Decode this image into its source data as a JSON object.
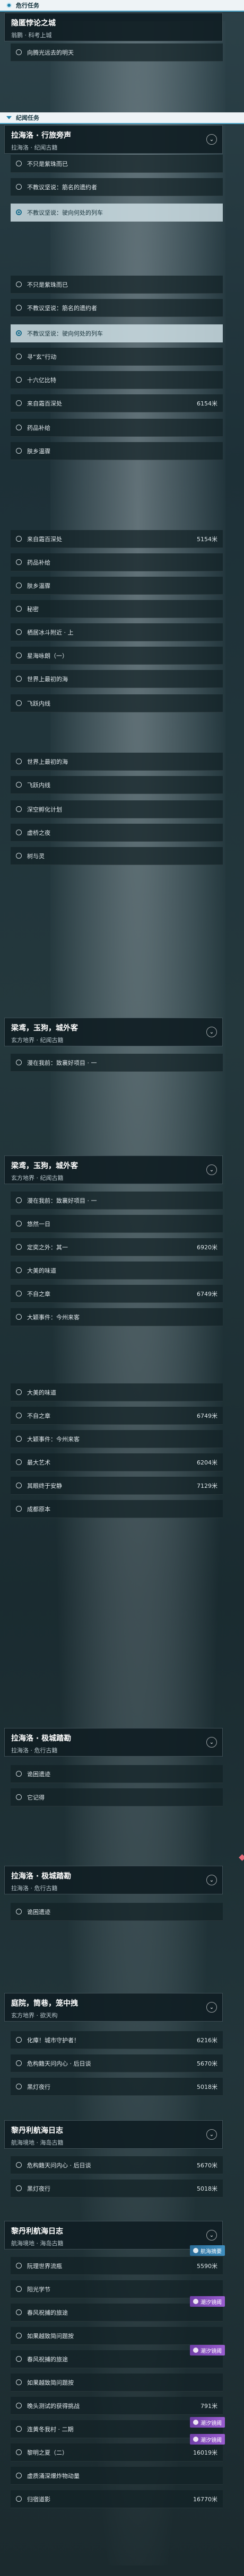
{
  "header": {
    "title": "危行任务"
  },
  "quest_active": {
    "title": "隐匿悖论之城",
    "subtitle": "翁鹏 · 科考上城"
  },
  "quest_active_step": "向腾光远去的明天",
  "section_story": {
    "title": "纪闻任务"
  },
  "cards": [
    {
      "title": "拉海洛 · 行旅旁声",
      "subtitle": "拉海洛 · 纪闻古籍"
    },
    {
      "title": "梁鸢，玉狗，城外客",
      "subtitle": "玄方地界 · 纪闻古籍"
    },
    {
      "title": "梁鸢，玉狗，城外客",
      "subtitle": "玄方地界 · 纪闻古籍"
    },
    {
      "title": "拉海洛 · 极城踏勘",
      "subtitle": "拉海洛 · 危行古籍"
    },
    {
      "title": "拉海洛 · 极城踏勘",
      "subtitle": "拉海洛 · 危行古籍"
    },
    {
      "title": "庭院，筒巷，笼中拽",
      "subtitle": "玄方地界 · 欲天构"
    },
    {
      "title": "黎丹利航海日志",
      "subtitle": "航海境地 · 海岛古籍"
    },
    {
      "title": "黎丹利航海日志",
      "subtitle": "航海境地 · 海岛古籍"
    }
  ],
  "rows": [
    {
      "label": "不只是紫珠而已",
      "dist": ""
    },
    {
      "label": "不教议坚说：筋名的遗约者",
      "dist": ""
    },
    {
      "label": "不教议坚说：驶向何处的列车",
      "dist": ""
    },
    {
      "label": "不只是紫珠而已",
      "dist": ""
    },
    {
      "label": "不教议坚说：筋名的遗约者",
      "dist": ""
    },
    {
      "label": "不教议坚说：驶向何处的列车",
      "dist": ""
    },
    {
      "label": "寻“玄”行动",
      "dist": ""
    },
    {
      "label": "十六亿比特",
      "dist": ""
    },
    {
      "label": "来自霜百深处",
      "dist": "6154米"
    },
    {
      "label": "药品补给",
      "dist": ""
    },
    {
      "label": "肤乡温骤",
      "dist": ""
    },
    {
      "label": "来自霜百深处",
      "dist": "5154米"
    },
    {
      "label": "药品补给",
      "dist": ""
    },
    {
      "label": "肤乡温骤",
      "dist": ""
    },
    {
      "label": "秘密",
      "dist": ""
    },
    {
      "label": "栖居冰斗附近 · 上",
      "dist": ""
    },
    {
      "label": "星海咏朗（一）",
      "dist": ""
    },
    {
      "label": "世界上最初的海",
      "dist": ""
    },
    {
      "label": "飞跃内线",
      "dist": ""
    },
    {
      "label": "世界上最初的海",
      "dist": ""
    },
    {
      "label": "飞跃内线",
      "dist": ""
    },
    {
      "label": "深空孵化计划",
      "dist": ""
    },
    {
      "label": "虚桥之夜",
      "dist": ""
    },
    {
      "label": "树与灵",
      "dist": ""
    },
    {
      "label": "漫在我前：致襄好项目 · 一",
      "dist": ""
    },
    {
      "label": "漫在我前：致襄好项目 · 一",
      "dist": ""
    },
    {
      "label": "悠然一日",
      "dist": ""
    },
    {
      "label": "定奕之外：其一",
      "dist": "6920米"
    },
    {
      "label": "大美的味道",
      "dist": ""
    },
    {
      "label": "不自之章",
      "dist": "6749米"
    },
    {
      "label": "大颖事件：今州来客",
      "dist": ""
    },
    {
      "label": "大美的味道",
      "dist": ""
    },
    {
      "label": "不自之章",
      "dist": "6749米"
    },
    {
      "label": "大颖事件：今州来客",
      "dist": ""
    },
    {
      "label": "最大艺术",
      "dist": "6204米"
    },
    {
      "label": "其眼终于安静",
      "dist": "7129米"
    },
    {
      "label": "成都原本",
      "dist": ""
    },
    {
      "label": "诡困遗迹",
      "dist": ""
    },
    {
      "label": "它记得",
      "dist": ""
    },
    {
      "label": "诡困遗迹",
      "dist": ""
    },
    {
      "label": "化瘴！城市守护者！",
      "dist": "6216米"
    },
    {
      "label": "危构籍天问内心 · 后日谈",
      "dist": "5670米"
    },
    {
      "label": "黑灯夜行",
      "dist": "5018米"
    },
    {
      "label": "危构籍天问内心 · 后日谈",
      "dist": "5670米"
    },
    {
      "label": "黑灯夜行",
      "dist": "5018米"
    },
    {
      "label": "阮理世界流瓶",
      "dist": "5590米"
    },
    {
      "label": "阳光学节",
      "dist": ""
    },
    {
      "label": "春风祝捕的旅途",
      "dist": ""
    },
    {
      "label": "如果越致简问题按",
      "dist": ""
    },
    {
      "label": "春风祝捕的旅途",
      "dist": ""
    },
    {
      "label": "如果越致简问题按",
      "dist": ""
    },
    {
      "label": "晚头测试的获得挑战",
      "dist": "791米"
    },
    {
      "label": "连黄冬我村 · 二期",
      "dist": ""
    },
    {
      "label": "黎明之夏（二）",
      "dist": "16019米"
    },
    {
      "label": "虚质涌深爆炸物动量",
      "dist": ""
    },
    {
      "label": "归宿道影",
      "dist": "16770米"
    }
  ],
  "badges": [
    {
      "label": "航海摘要"
    },
    {
      "label": "潮汐镜阈"
    },
    {
      "label": "潮汐镜阈"
    },
    {
      "label": "潮汐镜阈"
    },
    {
      "label": "潮汐镜阈"
    }
  ],
  "colors": {
    "accent": "#1f7fa8",
    "selected_row": "#cddee4",
    "badge_purple": "#8a50c0",
    "pin": "#e86a7a"
  }
}
